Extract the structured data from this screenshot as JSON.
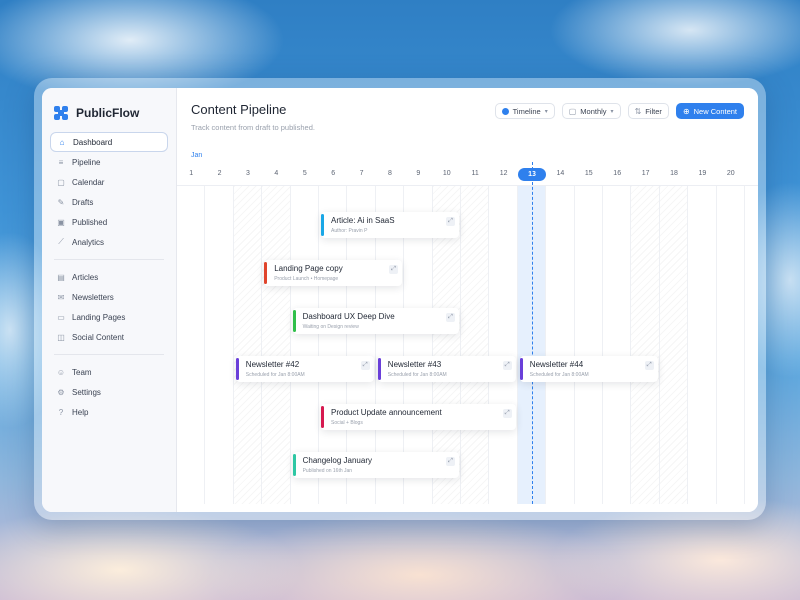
{
  "app": {
    "name": "PublicFlow"
  },
  "sidebar": {
    "groups": [
      [
        {
          "label": "Dashboard",
          "icon": "home-icon",
          "glyph": "⌂",
          "active": true
        },
        {
          "label": "Pipeline",
          "icon": "pipeline-icon",
          "glyph": "≡"
        },
        {
          "label": "Calendar",
          "icon": "calendar-icon",
          "glyph": "▢"
        },
        {
          "label": "Drafts",
          "icon": "edit-icon",
          "glyph": "✎"
        },
        {
          "label": "Published",
          "icon": "send-icon",
          "glyph": "▣"
        },
        {
          "label": "Analytics",
          "icon": "chart-icon",
          "glyph": "⟋"
        }
      ],
      [
        {
          "label": "Articles",
          "icon": "document-icon",
          "glyph": "▤"
        },
        {
          "label": "Newsletters",
          "icon": "mail-icon",
          "glyph": "✉"
        },
        {
          "label": "Landing Pages",
          "icon": "monitor-icon",
          "glyph": "▭"
        },
        {
          "label": "Social Content",
          "icon": "image-icon",
          "glyph": "◫"
        }
      ],
      [
        {
          "label": "Team",
          "icon": "users-icon",
          "glyph": "☺"
        },
        {
          "label": "Settings",
          "icon": "gear-icon",
          "glyph": "⚙"
        },
        {
          "label": "Help",
          "icon": "help-icon",
          "glyph": "?"
        }
      ]
    ]
  },
  "header": {
    "title": "Content Pipeline",
    "subtitle": "Track content from draft to published."
  },
  "toolbar": {
    "view_label": "Timeline",
    "period_label": "Monthly",
    "filter_label": "Filter",
    "new_label": "New Content"
  },
  "timeline": {
    "month": "Jan",
    "days": [
      1,
      2,
      3,
      4,
      5,
      6,
      7,
      8,
      9,
      10,
      11,
      12,
      13,
      14,
      15,
      16,
      17,
      18,
      19,
      20
    ],
    "today": 13,
    "hatched_days": [
      3,
      4,
      10,
      11,
      17,
      18
    ],
    "items": [
      {
        "title": "Article: Ai in SaaS",
        "sub": "Author: Pravin P",
        "color": "#1aa7e6",
        "start": 6,
        "span": 5,
        "row": 0
      },
      {
        "title": "Landing Page copy",
        "sub": "Product Launch  •  Homepage",
        "color": "#e0442c",
        "start": 4,
        "span": 5,
        "row": 1
      },
      {
        "title": "Dashboard UX Deep Dive",
        "sub": "Waiting on Design review",
        "color": "#2fbf4a",
        "start": 5,
        "span": 6,
        "row": 2
      },
      {
        "title": "Newsletter #42",
        "sub": "Scheduled for Jan 8:00AM",
        "color": "#6a3fd9",
        "start": 3,
        "span": 5,
        "row": 3
      },
      {
        "title": "Newsletter #43",
        "sub": "Scheduled for Jan 8:00AM",
        "color": "#6a3fd9",
        "start": 8,
        "span": 5,
        "row": 3
      },
      {
        "title": "Newsletter #44",
        "sub": "Scheduled for Jan 8:00AM",
        "color": "#6a3fd9",
        "start": 13,
        "span": 5,
        "row": 3
      },
      {
        "title": "Product Update announcement",
        "sub": "Social + Blogs",
        "color": "#d6194f",
        "start": 6,
        "span": 7,
        "row": 4
      },
      {
        "title": "Changelog January",
        "sub": "Published on 16th Jan",
        "color": "#2ec7a4",
        "start": 5,
        "span": 6,
        "row": 5
      }
    ]
  }
}
